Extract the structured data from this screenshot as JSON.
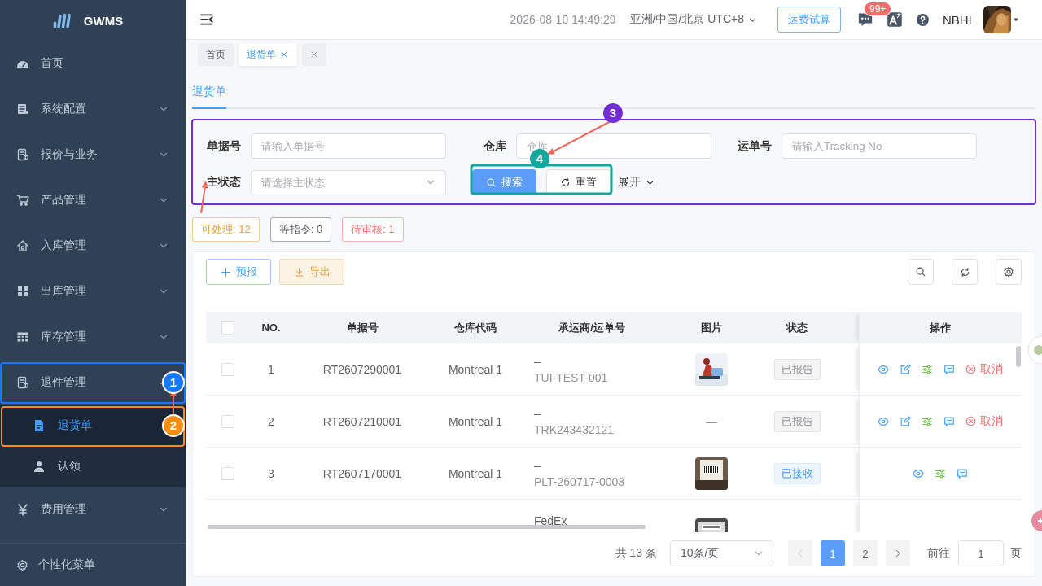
{
  "sidebar": {
    "logo": "GWMS",
    "items": [
      {
        "label": "首页"
      },
      {
        "label": "系统配置",
        "expanded": false
      },
      {
        "label": "报价与业务",
        "expanded": false
      },
      {
        "label": "产品管理",
        "expanded": false
      },
      {
        "label": "入库管理",
        "expanded": false
      },
      {
        "label": "出库管理",
        "expanded": false
      },
      {
        "label": "库存管理",
        "expanded": false
      },
      {
        "label": "退件管理",
        "expanded": true,
        "children": [
          {
            "label": "退货单",
            "selected": true
          },
          {
            "label": "认领",
            "selected": false
          }
        ]
      },
      {
        "label": "费用管理",
        "expanded": false
      }
    ],
    "footer": "个性化菜单"
  },
  "header": {
    "datetime": "2026-08-10 14:49:29",
    "timezone": "亚洲/中国/北京 UTC+8",
    "freight_button": "运费试算",
    "message_badge": "99+",
    "user": "NBHL"
  },
  "tags": [
    {
      "label": "首页",
      "selected": false,
      "closable": false
    },
    {
      "label": "退货单",
      "selected": true,
      "closable": true
    }
  ],
  "page_tabs": [
    {
      "label": "退货单",
      "selected": true
    }
  ],
  "filters": {
    "fields": [
      {
        "label": "单据号",
        "placeholder": "请输入单据号",
        "kind": "input"
      },
      {
        "label": "仓库",
        "placeholder": "仓库",
        "kind": "input"
      },
      {
        "label": "运单号",
        "placeholder": "请输入Tracking No",
        "kind": "input"
      },
      {
        "label": "主状态",
        "placeholder": "请选择主状态",
        "kind": "select"
      }
    ],
    "search_button": "搜索",
    "reset_button": "重置",
    "expand_toggle": "展开"
  },
  "status_counts": [
    {
      "label": "可处理: 12",
      "color": "#e6a23c"
    },
    {
      "label": "等指令: 0",
      "color": "#606266"
    },
    {
      "label": "待审核: 1",
      "color": "#f56c6c"
    }
  ],
  "toolbar": {
    "buttons": [
      {
        "label": "预报",
        "kind": "primary"
      },
      {
        "label": "导出",
        "kind": "warning"
      }
    ]
  },
  "table": {
    "header_checked": false,
    "columns": [
      "NO.",
      "单据号",
      "仓库代码",
      "承运商/运单号",
      "图片",
      "状态",
      "操作"
    ],
    "rows": [
      {
        "checked": false,
        "no": "1",
        "order_no": "RT2607290001",
        "warehouse": "Montreal 1",
        "carrier": "–",
        "tracking": "TUI-TEST-001",
        "image": {
          "kind": "picture"
        },
        "status": {
          "label": "已报告",
          "kind": "info"
        },
        "actions": [
          {
            "kind": "view"
          },
          {
            "kind": "edit"
          },
          {
            "kind": "adjust"
          },
          {
            "kind": "comment"
          },
          {
            "kind": "cancel",
            "label": "取消"
          }
        ]
      },
      {
        "checked": false,
        "no": "2",
        "order_no": "RT2607210001",
        "warehouse": "Montreal 1",
        "carrier": "–",
        "tracking": "TRK243432121",
        "image": {
          "kind": "empty",
          "text": "—"
        },
        "status": {
          "label": "已报告",
          "kind": "info"
        },
        "actions": [
          {
            "kind": "view"
          },
          {
            "kind": "edit"
          },
          {
            "kind": "adjust"
          },
          {
            "kind": "comment"
          },
          {
            "kind": "cancel",
            "label": "取消"
          }
        ]
      },
      {
        "checked": false,
        "no": "3",
        "order_no": "RT2607170001",
        "warehouse": "Montreal 1",
        "carrier": "–",
        "tracking": "PLT-260717-0003",
        "image": {
          "kind": "picture"
        },
        "status": {
          "label": "已接收",
          "kind": "primary"
        },
        "actions": [
          {
            "kind": "view"
          },
          {
            "kind": "adjust"
          },
          {
            "kind": "comment"
          }
        ]
      },
      {
        "carrier": "FedEx",
        "image": {
          "kind": "picture"
        }
      }
    ]
  },
  "pagination": {
    "total": "共 13 条",
    "page_size": "10条/页",
    "pages": [
      {
        "label": "1",
        "selected": true
      },
      {
        "label": "2",
        "selected": false
      }
    ],
    "goto_label": "前往",
    "goto_value": "1",
    "goto_unit": "页"
  },
  "annotations": [
    {
      "number": "1",
      "color": "#1677ff"
    },
    {
      "number": "2",
      "color": "#fa8c16"
    },
    {
      "number": "3",
      "color": "#722ed1"
    },
    {
      "number": "4",
      "color": "#13a89e"
    }
  ]
}
